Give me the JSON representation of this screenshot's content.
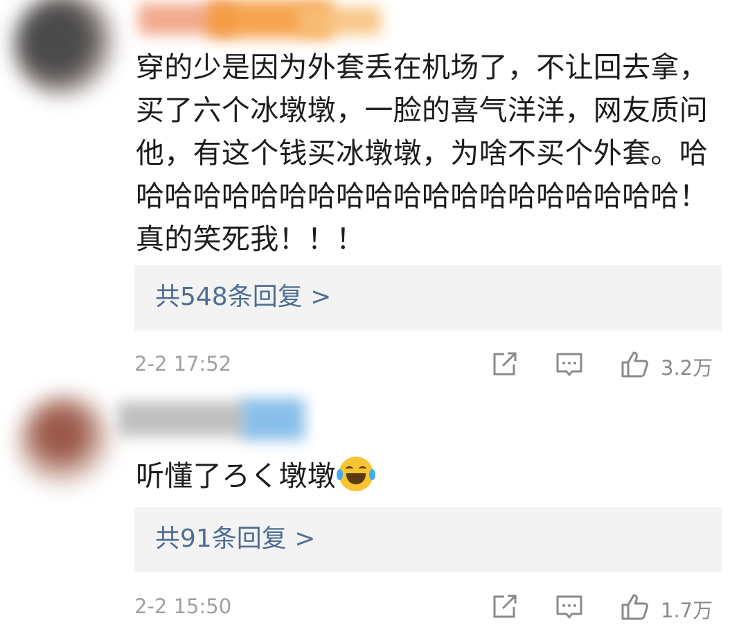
{
  "comments": [
    {
      "text": "穿的少是因为外套丢在机场了，不让回去拿，\n买了六个冰墩墩，一脸的喜气洋洋，网友质问\n他，有这个钱买冰墩墩，为啥不买个外套。哈\n哈哈哈哈哈哈哈哈哈哈哈哈哈哈哈哈哈哈哈！\n真的笑死我！！！",
      "replies_label": "共548条回复 >",
      "time": "2-2 17:52",
      "likes": "3.2万",
      "icons": {
        "share": "share-icon",
        "comment": "comment-icon",
        "like": "thumbs-up-icon"
      }
    },
    {
      "text": "听懂了ろく墩墩",
      "emoji": "laughing-crying-emoji",
      "replies_label": "共91条回复 >",
      "time": "2-2 15:50",
      "likes": "1.7万",
      "icons": {
        "share": "share-icon",
        "comment": "comment-icon",
        "like": "thumbs-up-icon"
      }
    }
  ],
  "colors": {
    "link": "#4e6d95",
    "meta": "#a0a0a0",
    "reply_bg": "#f3f3f3"
  }
}
